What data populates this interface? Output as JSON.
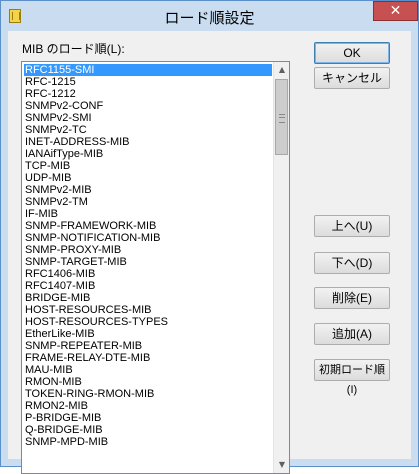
{
  "window": {
    "title": "ロード順設定",
    "close_glyph": "✕"
  },
  "list": {
    "label": "MIB のロード順(L):",
    "selected_index": 0,
    "items": [
      "RFC1155-SMI",
      "RFC-1215",
      "RFC-1212",
      "SNMPv2-CONF",
      "SNMPv2-SMI",
      "SNMPv2-TC",
      "INET-ADDRESS-MIB",
      "IANAifType-MIB",
      "TCP-MIB",
      "UDP-MIB",
      "SNMPv2-MIB",
      "SNMPv2-TM",
      "IF-MIB",
      "SNMP-FRAMEWORK-MIB",
      "SNMP-NOTIFICATION-MIB",
      "SNMP-PROXY-MIB",
      "SNMP-TARGET-MIB",
      "RFC1406-MIB",
      "RFC1407-MIB",
      "BRIDGE-MIB",
      "HOST-RESOURCES-MIB",
      "HOST-RESOURCES-TYPES",
      "EtherLike-MIB",
      "SNMP-REPEATER-MIB",
      "FRAME-RELAY-DTE-MIB",
      "MAU-MIB",
      "RMON-MIB",
      "TOKEN-RING-RMON-MIB",
      "RMON2-MIB",
      "P-BRIDGE-MIB",
      "Q-BRIDGE-MIB",
      "SNMP-MPD-MIB"
    ]
  },
  "scrollbar": {
    "up_glyph": "▲",
    "down_glyph": "▼"
  },
  "buttons": {
    "ok": "OK",
    "cancel": "キャンセル",
    "up": "上へ(U)",
    "down": "下へ(D)",
    "delete": "削除(E)",
    "add": "追加(A)",
    "reset": "初期ロード順(I)"
  },
  "colors": {
    "selection": "#3399ff",
    "title_bar": "#c9dcf0",
    "close_button": "#c75050"
  }
}
